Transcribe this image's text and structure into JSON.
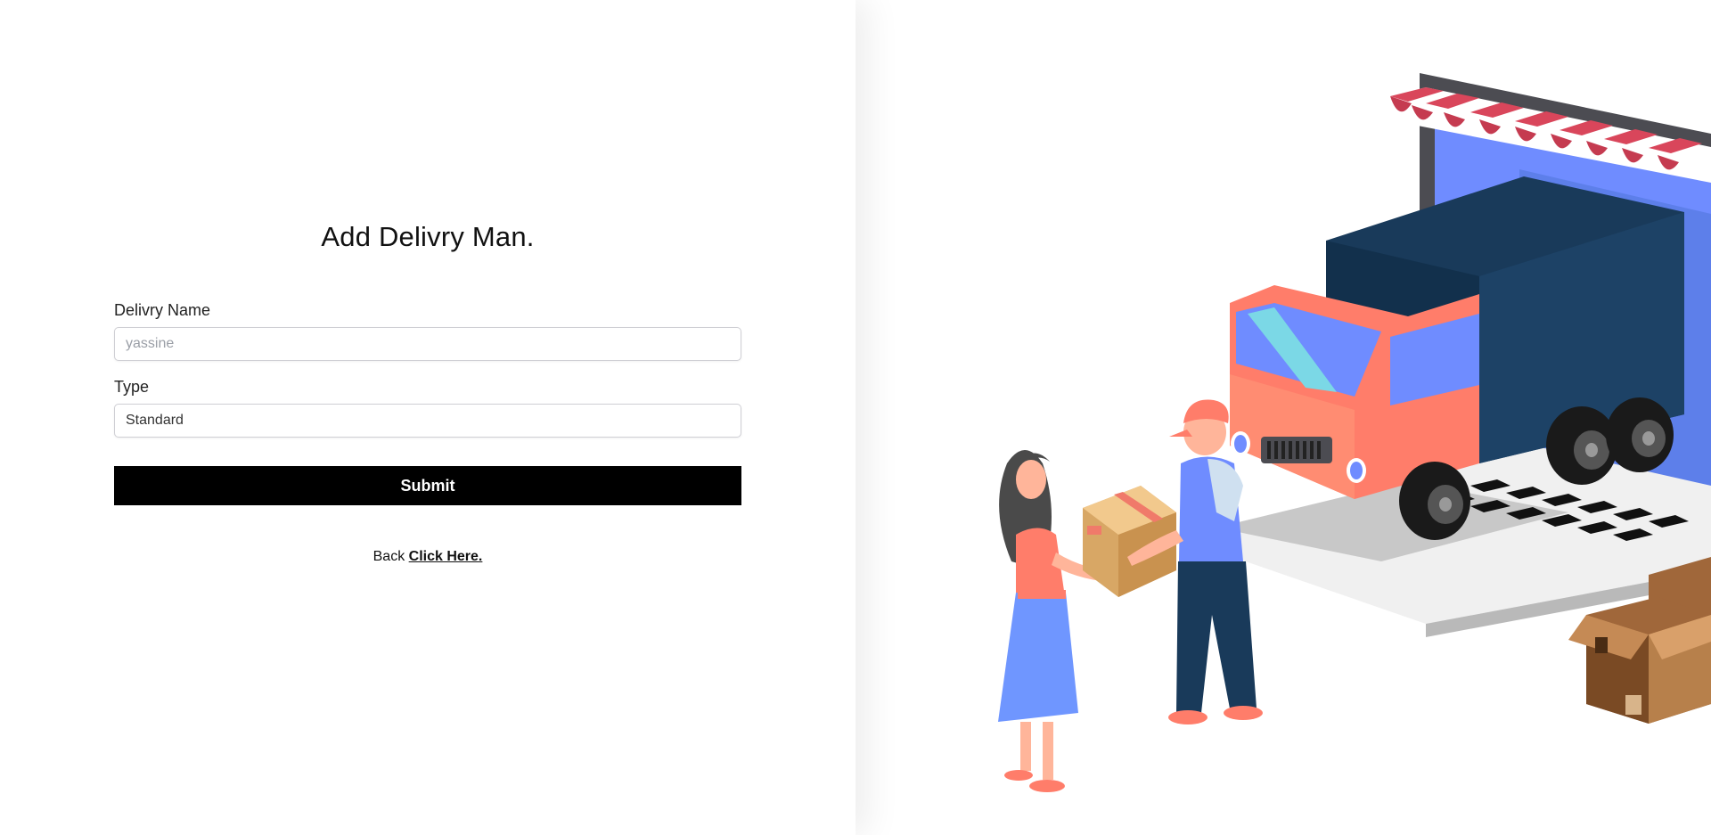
{
  "form": {
    "title": "Add Delivry Man.",
    "name_label": "Delivry Name",
    "name_placeholder": "yassine",
    "name_value": "",
    "type_label": "Type",
    "type_value": "Standard",
    "submit_label": "Submit",
    "back_text": "Back",
    "back_link": "Click Here."
  },
  "colors": {
    "button": "#000000",
    "truck_body": "#ff7d6a",
    "truck_cargo": "#193a5a",
    "screen": "#6f8cff",
    "box": "#d8a765"
  }
}
